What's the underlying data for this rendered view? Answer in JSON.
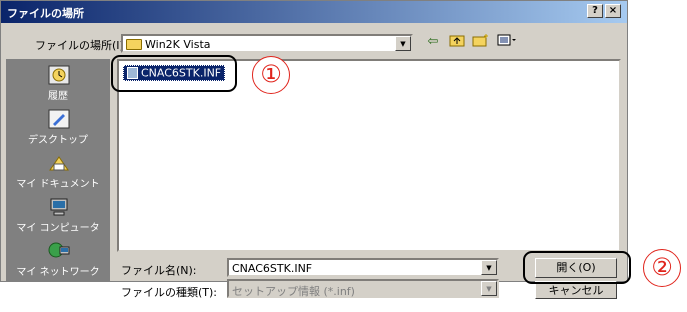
{
  "window": {
    "title": "ファイルの場所",
    "help_button": "?",
    "close_button": "×"
  },
  "lookin": {
    "label": "ファイルの場所(I):",
    "value": "Win2K Vista",
    "toolbar_icons": [
      "back-icon",
      "up-folder-icon",
      "new-folder-icon",
      "view-menu-icon"
    ]
  },
  "places": [
    {
      "label": "履歴",
      "icon": "history-icon"
    },
    {
      "label": "デスクトップ",
      "icon": "desktop-icon"
    },
    {
      "label": "マイ ドキュメント",
      "icon": "my-documents-icon"
    },
    {
      "label": "マイ コンピュータ",
      "icon": "my-computer-icon"
    },
    {
      "label": "マイ ネットワーク",
      "icon": "my-network-icon"
    }
  ],
  "files": [
    {
      "name": "CNAC6STK.INF",
      "selected": true
    }
  ],
  "filename": {
    "label": "ファイル名(N):",
    "value": "CNAC6STK.INF"
  },
  "filetype": {
    "label": "ファイルの種類(T):",
    "value": "セットアップ情報 (*.inf)"
  },
  "buttons": {
    "open": "開く(O)",
    "cancel": "キャンセル"
  },
  "callouts": [
    "①",
    "②"
  ],
  "colors": {
    "title_gradient_start": "#0a246a",
    "title_gradient_end": "#a6caf0",
    "selection": "#0a246a",
    "callout": "#e0241c"
  }
}
